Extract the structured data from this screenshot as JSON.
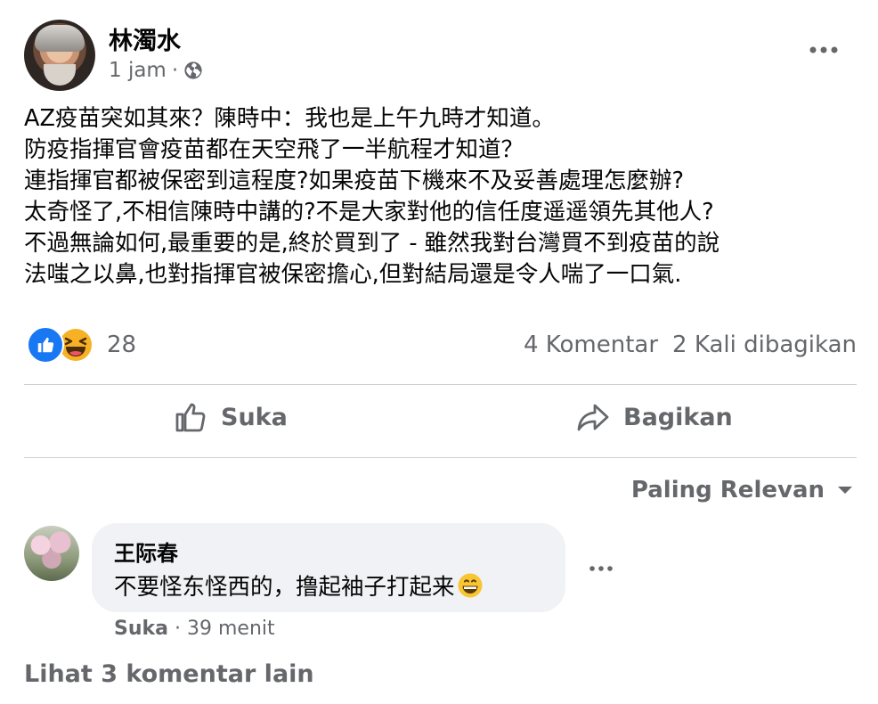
{
  "post": {
    "author": "林濁水",
    "time": "1 jam",
    "separator": "·",
    "privacy_icon": "globe-icon",
    "more_icon": "more-horizontal-icon",
    "body_lines": [
      "AZ疫苗突如其來？陳時中：我也是上午九時才知道。",
      "防疫指揮官會疫苗都在天空飛了一半航程才知道？",
      "連指揮官都被保密到這程度?如果疫苗下機來不及妥善處理怎麼辦?",
      "太奇怪了,不相信陳時中講的?不是大家對他的信任度遥遥領先其他人?",
      "不過無論如何,最重要的是,終於買到了 - 雖然我對台灣買不到疫苗的說",
      "法嗤之以鼻,也對指揮官被保密擔心,但對結局還是令人喘了一口氣."
    ]
  },
  "reactions": {
    "icons": [
      "like-reaction-icon",
      "haha-reaction-icon"
    ],
    "count": "28",
    "comments": "4 Komentar",
    "shares": "2 Kali dibagikan"
  },
  "actions": {
    "like_label": "Suka",
    "share_label": "Bagikan"
  },
  "sort": {
    "label": "Paling Relevan"
  },
  "comment": {
    "author": "王际春",
    "text": "不要怪东怪西的，撸起袖子打起来",
    "emoji": "grinning-face-icon",
    "like_label": "Suka",
    "separator": "·",
    "time": "39 menit"
  },
  "more_comments": "Lihat 3 komentar lain",
  "colors": {
    "text": "#050505",
    "secondary": "#65676b",
    "like_blue": "#1877f2",
    "bubble": "#f0f2f5",
    "divider": "#ced0d4"
  }
}
